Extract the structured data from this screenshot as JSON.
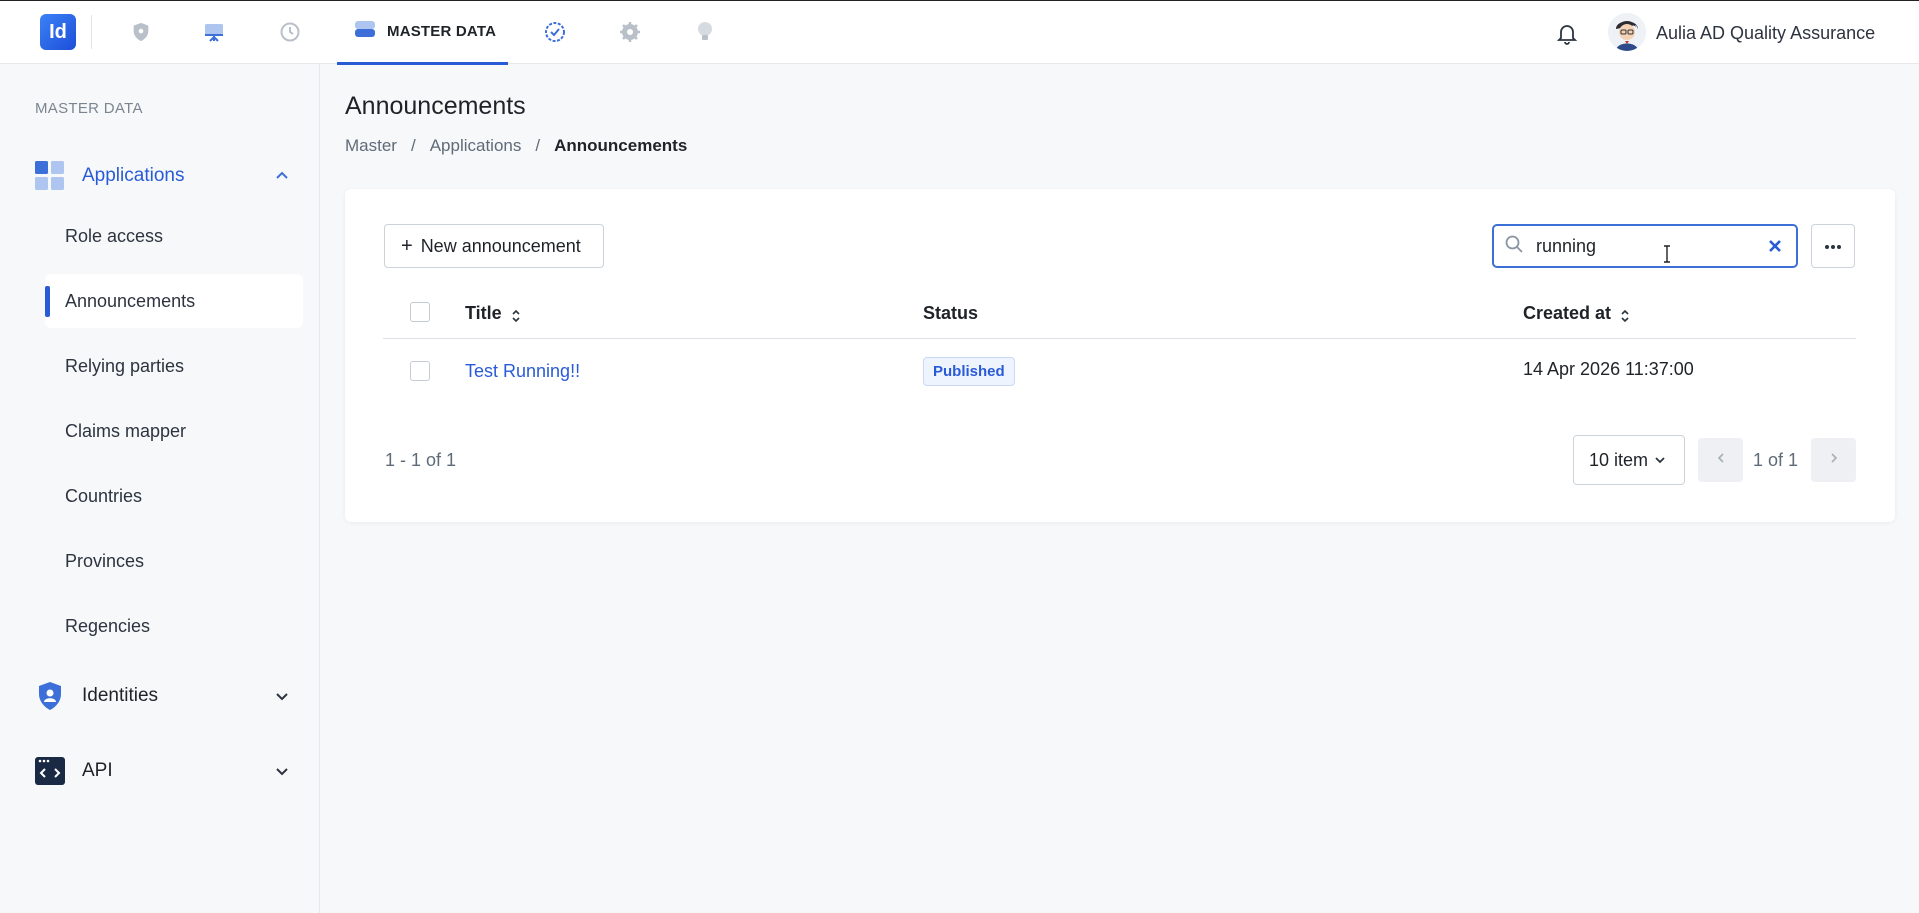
{
  "topbar": {
    "logo_text": "Id",
    "active_tab_label": "MASTER DATA",
    "nav_icons": [
      "shield-icon",
      "dashboard-icon",
      "history-icon",
      "database-icon",
      "badge-check-icon",
      "gear-icon",
      "lightbulb-icon"
    ],
    "user_name": "Aulia AD Quality Assurance"
  },
  "sidebar": {
    "section_label": "MASTER DATA",
    "groups": [
      {
        "label": "Applications",
        "expanded": true
      },
      {
        "label": "Identities",
        "expanded": false
      },
      {
        "label": "API",
        "expanded": false
      }
    ],
    "items": [
      {
        "label": "Role access"
      },
      {
        "label": "Announcements",
        "active": true
      },
      {
        "label": "Relying parties"
      },
      {
        "label": "Claims mapper"
      },
      {
        "label": "Countries"
      },
      {
        "label": "Provinces"
      },
      {
        "label": "Regencies"
      }
    ]
  },
  "page": {
    "title": "Announcements",
    "breadcrumb": [
      "Master",
      "Applications",
      "Announcements"
    ],
    "breadcrumb_sep": "/"
  },
  "toolbar": {
    "new_label": "New announcement",
    "new_plus": "+",
    "search_value": "running"
  },
  "table": {
    "headers": {
      "title": "Title",
      "status": "Status",
      "created_at": "Created at"
    },
    "rows": [
      {
        "title": "Test Running!!",
        "status": "Published",
        "created_at": "14 Apr 2026 11:37:00"
      }
    ]
  },
  "pagination": {
    "range": "1 - 1 of 1",
    "page_size": "10 item",
    "page_text": "1 of 1"
  },
  "colors": {
    "accent": "#2a5bd7",
    "badge_bg": "#eef4fd"
  }
}
